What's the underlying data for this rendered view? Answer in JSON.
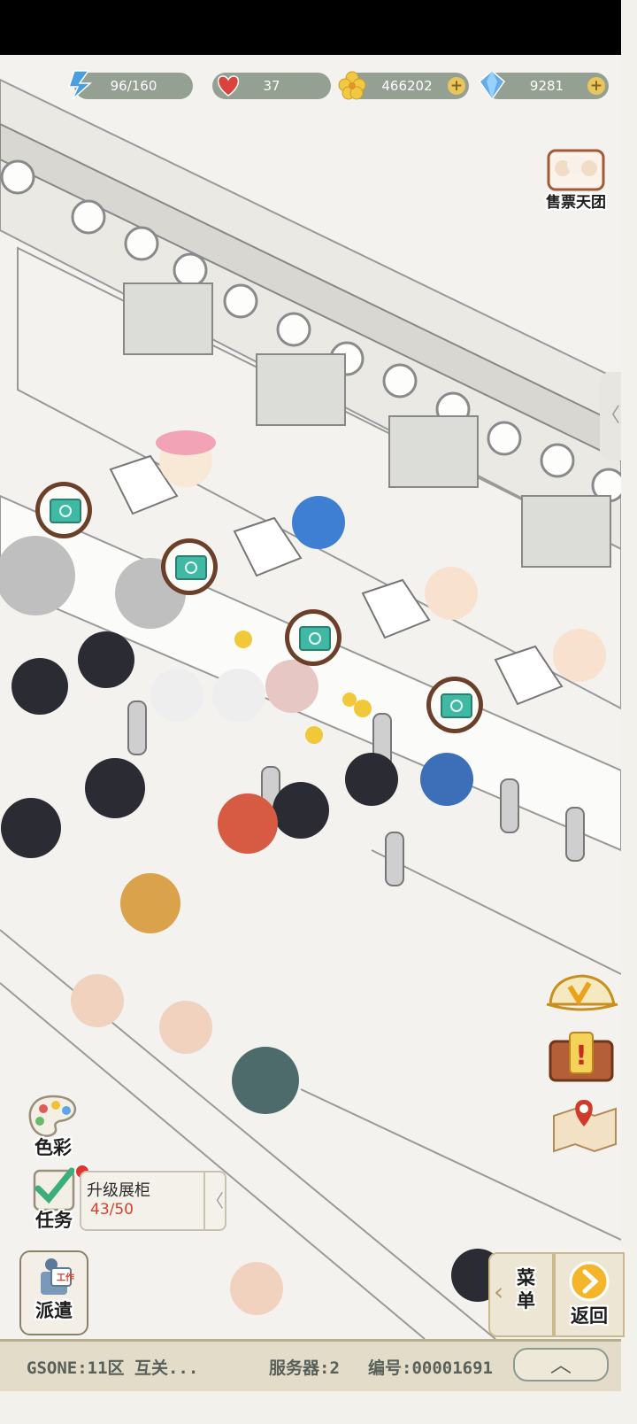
{
  "resources": {
    "stamina": {
      "value": "96/160",
      "icon": "lightning-icon"
    },
    "hearts": {
      "value": "37",
      "icon": "heart-icon"
    },
    "gold": {
      "value": "466202",
      "icon": "flower-coin-icon"
    },
    "gems": {
      "value": "9281",
      "icon": "diamond-icon"
    },
    "plus": "+"
  },
  "buttons": {
    "ticket_team": "售票天团",
    "color": "色彩",
    "task": "任务",
    "dispatch": "派遣",
    "dispatch_tag": "工作",
    "menu": "菜单",
    "back": "返回",
    "side_collapse": "〈"
  },
  "task": {
    "title": "升级展柜",
    "progress": "43/50",
    "collapse": "〈"
  },
  "bottom_bar": {
    "left": "GSONE:11区 互关...",
    "server": "服务器:2",
    "id": "编号:00001691",
    "expand": "︿"
  },
  "colors": {
    "resource_pill": "#8c9a8a",
    "money_icon": "#3fb9a3",
    "bubble_border": "#6b3f29",
    "bottom_bar": "#e3dcc8"
  }
}
